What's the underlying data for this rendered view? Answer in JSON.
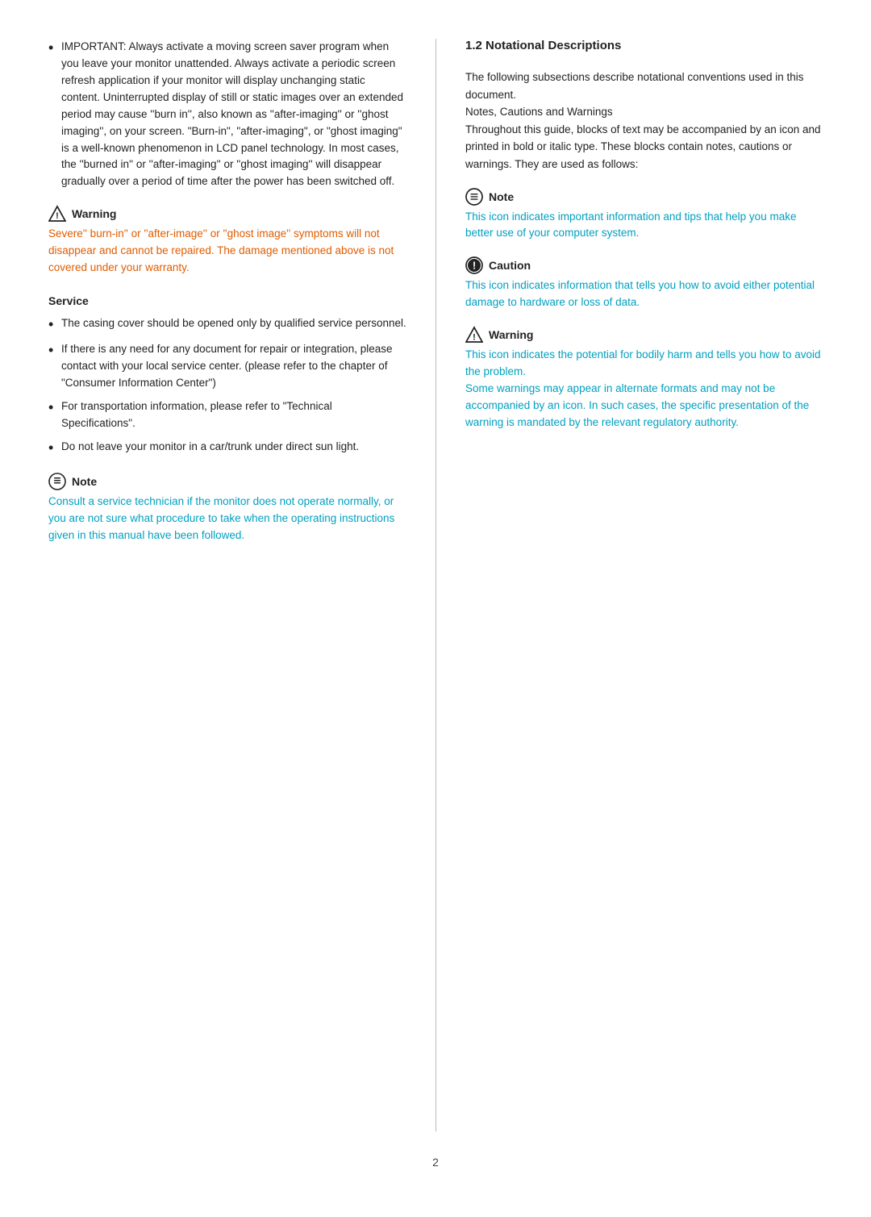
{
  "page": {
    "number": "2"
  },
  "left_column": {
    "intro_bullet": "IMPORTANT: Always activate a moving screen saver program when you leave your monitor unattended. Always activate a periodic screen refresh application if your monitor will display unchanging static content. Uninterrupted display of still or static images over an extended period may cause ''burn in'', also known as ''after-imaging'' or ''ghost imaging'',  on your screen. \"Burn-in\", \"after-imaging\", or \"ghost imaging\" is a well-known phenomenon in LCD panel technology. In most cases, the ''burned in'' or ''after-imaging'' or ''ghost imaging'' will disappear gradually over a period of time after the power has been switched off.",
    "warning1": {
      "title": "Warning",
      "text": "Severe'' burn-in'' or ''after-image'' or ''ghost image'' symptoms will not disappear and cannot be repaired. The damage mentioned above is not covered under your warranty."
    },
    "service_heading": "Service",
    "service_bullets": [
      "The casing cover should be opened only by qualified service personnel.",
      "If there is any need for any document for repair or integration, please contact with your local service center. (please refer to the chapter of \"Consumer Information Center\")",
      "For transportation information, please refer to \"Technical Specifications\".",
      "Do not leave your monitor in a car/trunk under direct sun light."
    ],
    "note1": {
      "title": "Note",
      "text": "Consult a service technician if the monitor does not operate normally, or you are not sure what procedure to take when the operating instructions given in this manual have been followed."
    }
  },
  "right_column": {
    "section_title": "1.2  Notational Descriptions",
    "intro": "The following subsections describe notational conventions used in this document.\nNotes, Cautions and Warnings\nThroughout this guide, blocks of text may be accompanied by an icon and printed in bold or italic type. These blocks contain notes, cautions or warnings. They are used as follows:",
    "note": {
      "title": "Note",
      "text": "This icon indicates important information and tips that help you make better use of your computer system."
    },
    "caution": {
      "title": "Caution",
      "text": "This icon indicates information that tells you how to avoid either potential damage to hardware or loss of data."
    },
    "warning": {
      "title": "Warning",
      "text": "This icon indicates the potential for bodily harm and tells you how to avoid the problem.\nSome warnings may appear in alternate formats and may not be accompanied by an icon. In such cases, the specific presentation of the warning is mandated by the relevant regulatory authority."
    }
  }
}
